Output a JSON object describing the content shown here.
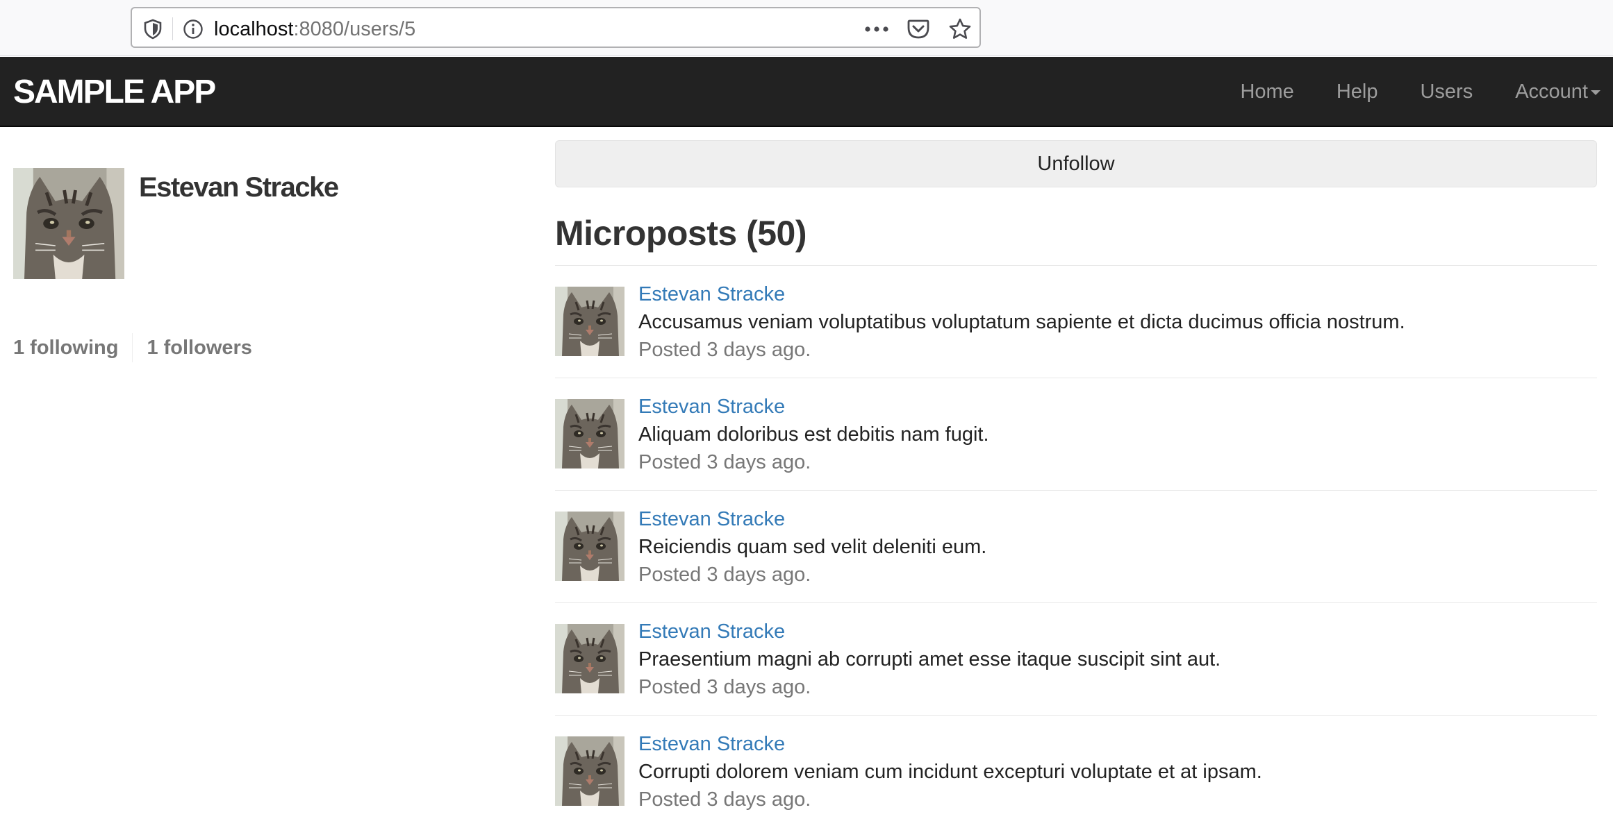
{
  "browser": {
    "url_host": "localhost",
    "url_rest": ":8080/users/5",
    "icons": [
      "shield-icon",
      "info-icon",
      "more-icon",
      "pocket-icon",
      "star-icon"
    ]
  },
  "navbar": {
    "logo": "SAMPLE APP",
    "links": {
      "home": "Home",
      "help": "Help",
      "users": "Users",
      "account": "Account"
    }
  },
  "profile": {
    "name": "Estevan Stracke",
    "following": "1 following",
    "followers": "1 followers"
  },
  "main": {
    "unfollow_label": "Unfollow",
    "microposts_title": "Microposts (50)",
    "posts": [
      {
        "user": "Estevan Stracke",
        "content": "Accusamus veniam voluptatibus voluptatum sapiente et dicta ducimus officia nostrum.",
        "timestamp": "Posted 3 days ago."
      },
      {
        "user": "Estevan Stracke",
        "content": "Aliquam doloribus est debitis nam fugit.",
        "timestamp": "Posted 3 days ago."
      },
      {
        "user": "Estevan Stracke",
        "content": "Reiciendis quam sed velit deleniti eum.",
        "timestamp": "Posted 3 days ago."
      },
      {
        "user": "Estevan Stracke",
        "content": "Praesentium magni ab corrupti amet esse itaque suscipit sint aut.",
        "timestamp": "Posted 3 days ago."
      },
      {
        "user": "Estevan Stracke",
        "content": "Corrupti dolorem veniam cum incidunt excepturi voluptate et at ipsam.",
        "timestamp": "Posted 3 days ago."
      }
    ]
  },
  "colors": {
    "navbar_bg": "#222222",
    "link": "#337ab7",
    "muted": "#777777"
  }
}
